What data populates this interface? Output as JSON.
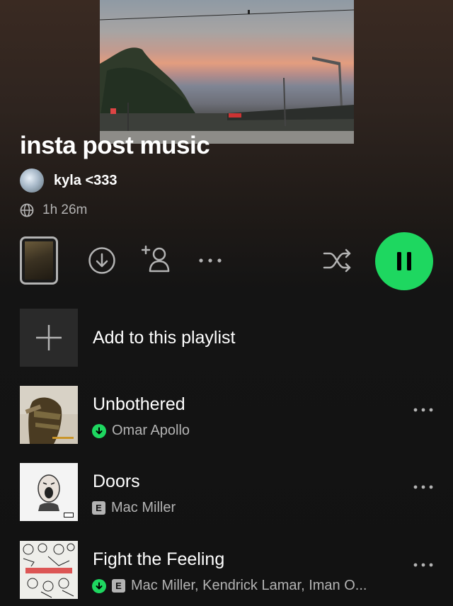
{
  "playlist": {
    "title": "insta post music",
    "owner": "kyla <333",
    "duration": "1h 26m"
  },
  "icons": {
    "visibility": "globe-icon",
    "download": "download-circle-icon",
    "add_user": "add-user-icon",
    "more": "more-horizontal-icon",
    "shuffle": "shuffle-icon",
    "play_pause": "pause-icon",
    "add": "plus-icon"
  },
  "add_row": {
    "label": "Add to this playlist"
  },
  "tracks": [
    {
      "title": "Unbothered",
      "artist": "Omar Apollo",
      "downloaded": true,
      "explicit": false
    },
    {
      "title": "Doors",
      "artist": "Mac Miller",
      "downloaded": false,
      "explicit": true,
      "explicit_label": "E"
    },
    {
      "title": "Fight the Feeling",
      "artist": "Mac Miller, Kendrick Lamar, Iman O...",
      "downloaded": true,
      "explicit": true,
      "explicit_label": "E"
    }
  ],
  "colors": {
    "accent": "#1ed760",
    "background": "#121212",
    "secondary_text": "#b3b3b3"
  }
}
